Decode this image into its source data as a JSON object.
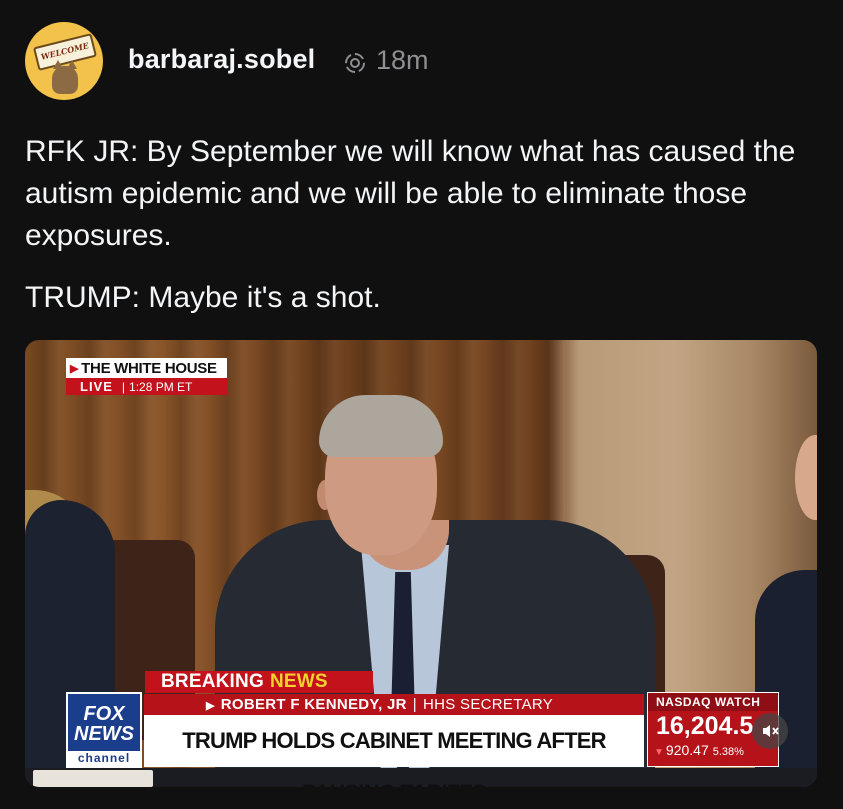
{
  "post": {
    "username": "barbaraj.sobel",
    "timestamp": "18m",
    "avatar_sign_text": "WELCOME",
    "paragraphs": [
      "RFK JR: By September we will know what has caused the autism epidemic and we will be able to eliminate those exposures.",
      "TRUMP: Maybe it's a shot."
    ]
  },
  "video": {
    "bug": {
      "title": "THE WHITE HOUSE",
      "live": "LIVE",
      "time": "1:28 PM ET"
    },
    "lower_third": {
      "breaking": "BREAKING",
      "news": "NEWS",
      "network_top": "FOX",
      "network_mid": "NEWS",
      "network_bottom": "channel",
      "subject_name": "ROBERT F KENNEDY, JR",
      "subject_role": "HHS SECRETARY",
      "headline": "TRUMP HOLDS CABINET MEETING AFTER PAUSING TARIFFS"
    },
    "ticker": {
      "label": "NASDAQ WATCH",
      "value": "16,204.5",
      "change": "920.47",
      "percent": "5.38%"
    }
  },
  "icons": {
    "reshare": "reshare-icon",
    "mute": "speaker-muted-icon"
  },
  "colors": {
    "background": "#101010",
    "fox_red": "#c3121b",
    "fox_blue": "#1b3e8c",
    "timestamp_gray": "#8e8e93"
  }
}
